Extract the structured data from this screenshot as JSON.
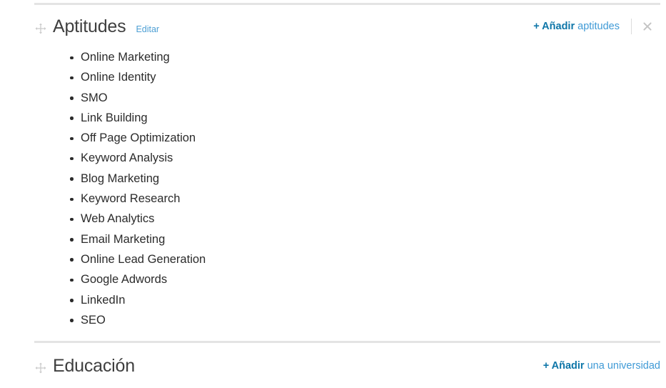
{
  "colors": {
    "link_strong": "#0e76a8",
    "link_light": "#3f9ad6",
    "edit_link": "#4d9fd4",
    "heading": "#3f3f3f",
    "text": "#2b2b2b",
    "divider": "#e4e4e4",
    "icon_gray": "#c9c9c9"
  },
  "skills_section": {
    "title": "Aptitudes",
    "edit_label": "Editar",
    "move_icon": "move-handle-icon",
    "add_link": {
      "strong": "+ Añadir",
      "light": "aptitudes"
    },
    "close_icon": "close-icon",
    "items": [
      "Online Marketing",
      "Online Identity",
      "SMO",
      "Link Building",
      "Off Page Optimization",
      "Keyword Analysis",
      "Blog Marketing",
      "Keyword Research",
      "Web Analytics",
      "Email Marketing",
      "Online Lead Generation",
      "Google Adwords",
      "LinkedIn",
      "SEO"
    ]
  },
  "education_section": {
    "title": "Educación",
    "move_icon": "move-handle-icon",
    "add_link": {
      "strong": "+ Añadir",
      "light": "una universidad"
    }
  }
}
